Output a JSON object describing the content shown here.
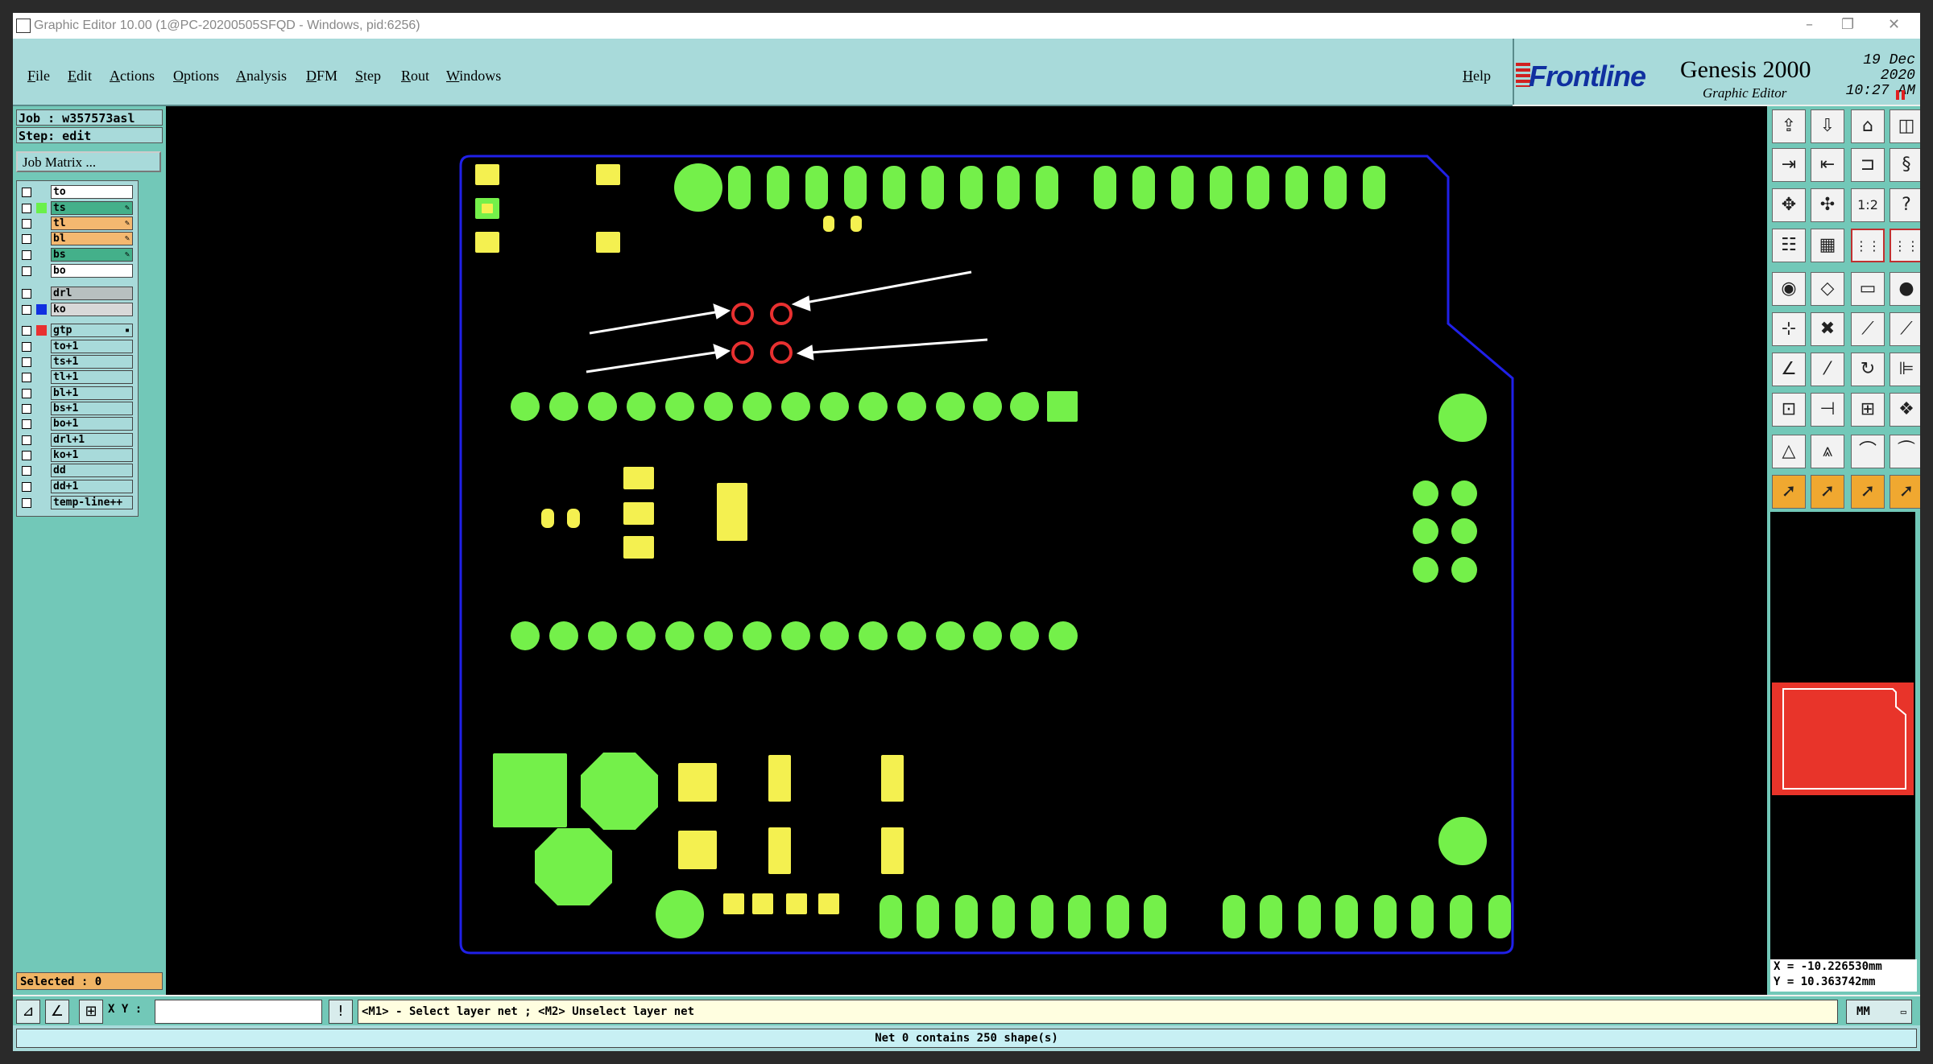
{
  "window": {
    "title": "Graphic Editor 10.00 (1@PC-20200505SFQD - Windows, pid:6256)",
    "controls": [
      "–",
      "❐",
      "✕"
    ]
  },
  "menu": {
    "items": [
      "File",
      "Edit",
      "Actions",
      "Options",
      "Analysis",
      "DFM",
      "Step",
      "Rout",
      "Windows"
    ],
    "help": "Help"
  },
  "brand": {
    "logo": "Frontline",
    "product": "Genesis 2000",
    "subtitle": "Graphic Editor",
    "date_line1": "19 Dec 2020",
    "date_line2": "10:27 AM"
  },
  "left": {
    "job": "Job : w357573asl",
    "step": "Step: edit",
    "job_matrix": "Job Matrix ...",
    "selected": "Selected : 0",
    "layers": [
      {
        "name": "to",
        "color": "#ffffff",
        "swatch": "",
        "flag": ""
      },
      {
        "name": "ts",
        "color": "#44b08a",
        "swatch": "#6af04a",
        "flag": "✎"
      },
      {
        "name": "tl",
        "color": "#f4b870",
        "swatch": "",
        "flag": "✎"
      },
      {
        "name": "bl",
        "color": "#f4b870",
        "swatch": "",
        "flag": "✎"
      },
      {
        "name": "bs",
        "color": "#44b08a",
        "swatch": "",
        "flag": "✎"
      },
      {
        "name": "bo",
        "color": "#ffffff",
        "swatch": "",
        "flag": ""
      },
      {
        "name": "drl",
        "color": "#b8c0c0",
        "swatch": "",
        "flag": ""
      },
      {
        "name": "ko",
        "color": "#d8d8d8",
        "swatch": "#1030e0",
        "flag": ""
      },
      {
        "name": "gtp",
        "color": "#a8dada",
        "swatch": "#e83030",
        "flag": "▪"
      },
      {
        "name": "to+1",
        "color": "#a8dada",
        "swatch": "",
        "flag": ""
      },
      {
        "name": "ts+1",
        "color": "#a8dada",
        "swatch": "",
        "flag": ""
      },
      {
        "name": "tl+1",
        "color": "#a8dada",
        "swatch": "",
        "flag": ""
      },
      {
        "name": "bl+1",
        "color": "#a8dada",
        "swatch": "",
        "flag": ""
      },
      {
        "name": "bs+1",
        "color": "#a8dada",
        "swatch": "",
        "flag": ""
      },
      {
        "name": "bo+1",
        "color": "#a8dada",
        "swatch": "",
        "flag": ""
      },
      {
        "name": "drl+1",
        "color": "#a8dada",
        "swatch": "",
        "flag": ""
      },
      {
        "name": "ko+1",
        "color": "#a8dada",
        "swatch": "",
        "flag": ""
      },
      {
        "name": "dd",
        "color": "#a8dada",
        "swatch": "",
        "flag": ""
      },
      {
        "name": "dd+1",
        "color": "#a8dada",
        "swatch": "",
        "flag": ""
      },
      {
        "name": "temp-line++",
        "color": "#a8dada",
        "swatch": "",
        "flag": ""
      }
    ]
  },
  "tools": [
    {
      "name": "open-job-tool-icon",
      "glyph": "⇪",
      "style": ""
    },
    {
      "name": "save-tool-icon",
      "glyph": "⇩",
      "style": ""
    },
    {
      "name": "home-tool-icon",
      "glyph": "⌂",
      "style": ""
    },
    {
      "name": "panel-tool-icon",
      "glyph": "◫",
      "style": ""
    },
    {
      "name": "step-in-tool-icon",
      "glyph": "⇥",
      "style": ""
    },
    {
      "name": "step-out-tool-icon",
      "glyph": "⇤",
      "style": ""
    },
    {
      "name": "snap-tool-icon",
      "glyph": "⊐",
      "style": ""
    },
    {
      "name": "route-tool-icon",
      "glyph": "§",
      "style": ""
    },
    {
      "name": "zoom-fit-tool-icon",
      "glyph": "✥",
      "style": ""
    },
    {
      "name": "zoom-home-tool-icon",
      "glyph": "✣",
      "style": ""
    },
    {
      "name": "scale-tool-icon",
      "glyph": "1:2",
      "style": ""
    },
    {
      "name": "help-tool-icon",
      "glyph": "?",
      "style": ""
    },
    {
      "name": "filter-tool-icon",
      "glyph": "☷",
      "style": ""
    },
    {
      "name": "grid-tool-icon",
      "glyph": "▦",
      "style": ""
    },
    {
      "name": "net-tool-icon",
      "glyph": "⋮⋮",
      "style": "red"
    },
    {
      "name": "net-select-tool-icon",
      "glyph": "⋮⋮",
      "style": "red"
    },
    {
      "name": "pad-tool-icon",
      "glyph": "◉",
      "style": ""
    },
    {
      "name": "surface-tool-icon",
      "glyph": "◇",
      "style": ""
    },
    {
      "name": "measure-tool-icon",
      "glyph": "▭",
      "style": ""
    },
    {
      "name": "point-tool-icon",
      "glyph": "●",
      "style": ""
    },
    {
      "name": "connect-tool-icon",
      "glyph": "⊹",
      "style": ""
    },
    {
      "name": "delete-node-tool-icon",
      "glyph": "✖",
      "style": ""
    },
    {
      "name": "line-node-tool-icon",
      "glyph": "⟋",
      "style": ""
    },
    {
      "name": "arc-node-tool-icon",
      "glyph": "⟋",
      "style": ""
    },
    {
      "name": "angle-tool-icon",
      "glyph": "∠",
      "style": ""
    },
    {
      "name": "slash-tool-icon",
      "glyph": "⁄",
      "style": ""
    },
    {
      "name": "rotate-tool-icon",
      "glyph": "↻",
      "style": ""
    },
    {
      "name": "mirror-tool-icon",
      "glyph": "⊫",
      "style": ""
    },
    {
      "name": "move-tool-icon",
      "glyph": "⊡",
      "style": ""
    },
    {
      "name": "split-tool-icon",
      "glyph": "⊣",
      "style": ""
    },
    {
      "name": "copy-tool-icon",
      "glyph": "⊞",
      "style": ""
    },
    {
      "name": "array-tool-icon",
      "glyph": "❖",
      "style": ""
    },
    {
      "name": "triangle-tool-icon",
      "glyph": "△",
      "style": ""
    },
    {
      "name": "peak-tool-icon",
      "glyph": "⩓",
      "style": ""
    },
    {
      "name": "arch-tool-icon",
      "glyph": "⌒",
      "style": ""
    },
    {
      "name": "bridge-tool-icon",
      "glyph": "⏜",
      "style": ""
    },
    {
      "name": "select-tool-icon",
      "glyph": "➚",
      "style": "orange"
    },
    {
      "name": "select-add-tool-icon",
      "glyph": "➚",
      "style": "orange"
    },
    {
      "name": "select-box-tool-icon",
      "glyph": "➚",
      "style": "orange"
    },
    {
      "name": "select-net-tool-icon",
      "glyph": "➚",
      "style": "orange"
    }
  ],
  "coords": {
    "x": "X = -10.226530mm",
    "y": "Y = 10.363742mm"
  },
  "cmd": {
    "xy_label": "X Y :",
    "xy_value": "",
    "prompt": "<M1> - Select layer net ; <M2> Unselect layer net",
    "units": "MM",
    "units_arrow": "▭"
  },
  "status": {
    "message": "Net 0 contains 250 shape(s)"
  },
  "colors": {
    "pad_green": "#74f04a",
    "pad_yellow": "#f4f050",
    "outline": "#2020e8",
    "highlight": "#e83030",
    "arrow": "#ffffff"
  }
}
